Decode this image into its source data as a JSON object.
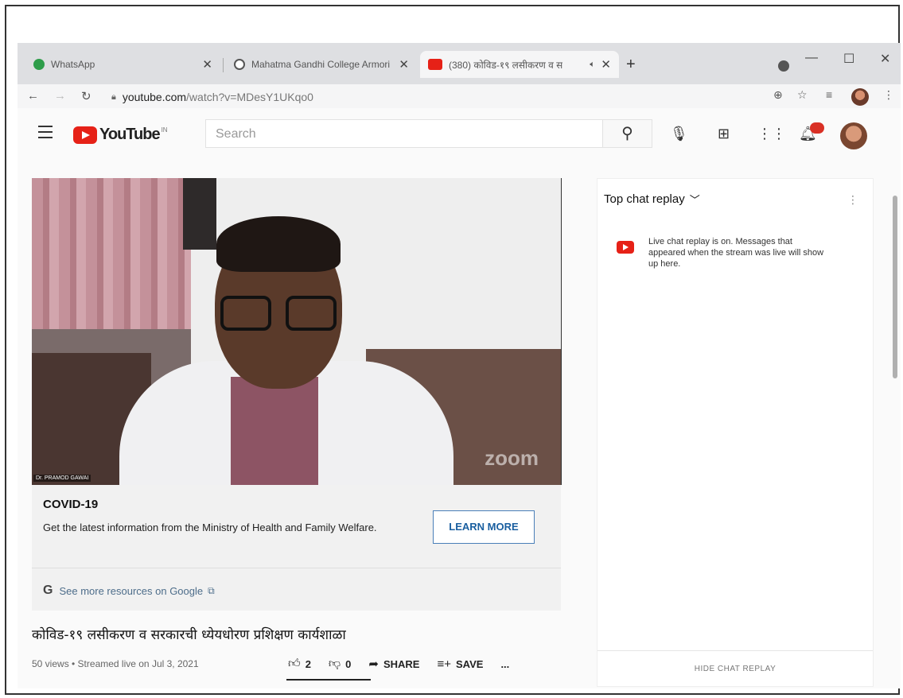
{
  "tabs": [
    {
      "title": "WhatsApp",
      "favicon_color": "#2e9d4a",
      "active": false
    },
    {
      "title": "Mahatma Gandhi College Armori",
      "favicon_color": "#555555",
      "active": false
    },
    {
      "title": "(380) कोविड-१९ लसीकरण व स",
      "favicon_color": "#e62117",
      "active": true
    }
  ],
  "address": {
    "host": "youtube.com",
    "path": "/watch?v=MDesY1UKqo0"
  },
  "youtube": {
    "logo_text": "YouTube",
    "country": "IN",
    "search_placeholder": "Search"
  },
  "video": {
    "name_label": "Dr. PRAMOD GAWAI",
    "watermark": "zoom"
  },
  "covid": {
    "title": "COVID-19",
    "text": "Get the latest information from the Ministry of Health and Family Welfare.",
    "button": "LEARN MORE",
    "link": "See more resources on Google"
  },
  "info": {
    "title": "कोविड-१९ लसीकरण व सरकारची ध्येयधोरण प्रशिक्षण कार्यशाळा",
    "meta": "50 views • Streamed live on Jul 3, 2021",
    "likes": "2",
    "dislikes": "0",
    "share": "SHARE",
    "save": "SAVE",
    "more": "..."
  },
  "chat": {
    "header": "Top chat replay",
    "notice": "Live chat replay is on. Messages that appeared when the stream was live will show up here.",
    "hide": "HIDE CHAT REPLAY"
  }
}
